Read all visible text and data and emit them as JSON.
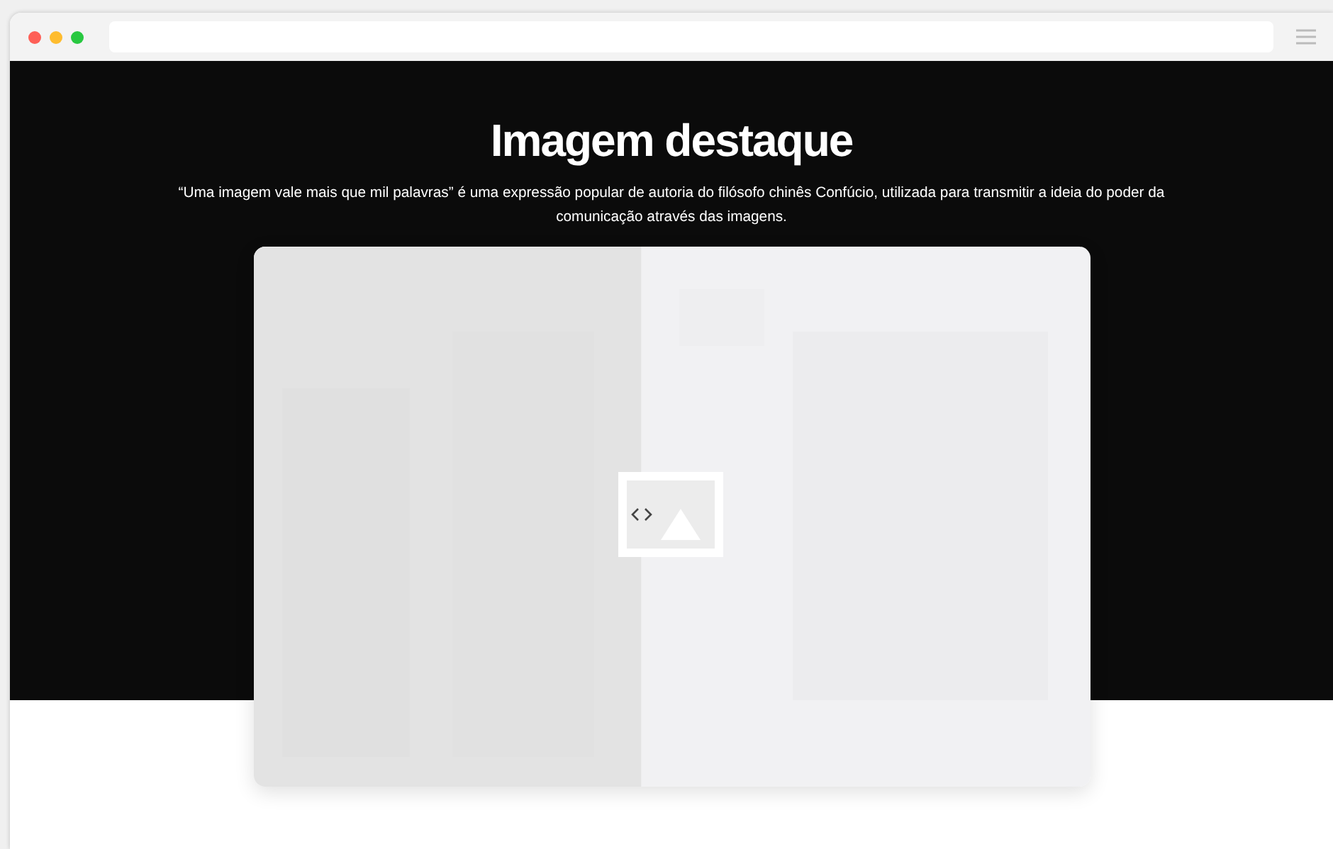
{
  "hero": {
    "title": "Imagem destaque",
    "description": "“Uma imagem vale mais que mil palavras” é uma expressão popular de autoria do filósofo chinês Confúcio, utilizada para transmitir a ideia do poder da comunicação através das imagens."
  },
  "comparison": {
    "kind": "picture",
    "level": 0.463
  }
}
